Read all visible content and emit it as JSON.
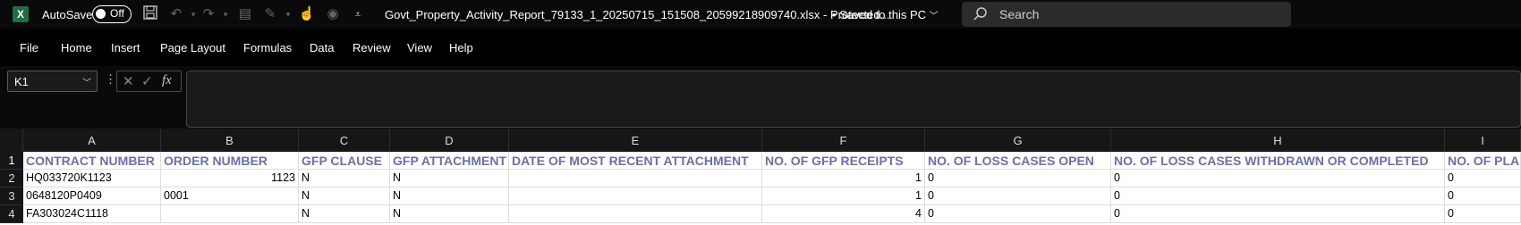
{
  "titlebar": {
    "app_icon_letter": "X",
    "autosave_label": "AutoSave",
    "autosave_state": "Off",
    "document_title": "Govt_Property_Activity_Report_79133_1_20250715_151508_20599218909740.xlsx  -  Protected...",
    "save_status": "Saved to this PC",
    "search_placeholder": "Search"
  },
  "menu": [
    "File",
    "Home",
    "Insert",
    "Page Layout",
    "Formulas",
    "Data",
    "Review",
    "View",
    "Help"
  ],
  "formula_bar": {
    "name_box": "K1",
    "cancel_glyph": "✕",
    "enter_glyph": "✓",
    "fx_glyph": "fx",
    "formula": ""
  },
  "sheet": {
    "columns": [
      "A",
      "B",
      "C",
      "D",
      "E",
      "F",
      "G",
      "H",
      "I"
    ],
    "rows": [
      "1",
      "2",
      "3",
      "4"
    ],
    "cells": [
      [
        "CONTRACT NUMBER",
        "ORDER NUMBER",
        "GFP CLAUSE",
        "GFP ATTACHMENT",
        "DATE OF MOST RECENT ATTACHMENT",
        "NO. OF GFP RECEIPTS",
        "NO. OF LOSS CASES OPEN",
        "NO. OF LOSS CASES WITHDRAWN OR COMPLETED",
        "NO. OF PLA"
      ],
      [
        "HQ033720K1123",
        "1123",
        "N",
        "N",
        "",
        "1",
        "0",
        "0",
        "0"
      ],
      [
        "0648120P0409",
        "0001",
        "N",
        "N",
        "",
        "1",
        "0",
        "0",
        "0"
      ],
      [
        "FA303024C1118",
        "",
        "N",
        "N",
        "",
        "4",
        "0",
        "0",
        "0"
      ]
    ],
    "header_color": "#6b6fa8"
  },
  "colors": {
    "excel_green": "#1d6f42",
    "chrome_dark": "#0a0a0a"
  }
}
